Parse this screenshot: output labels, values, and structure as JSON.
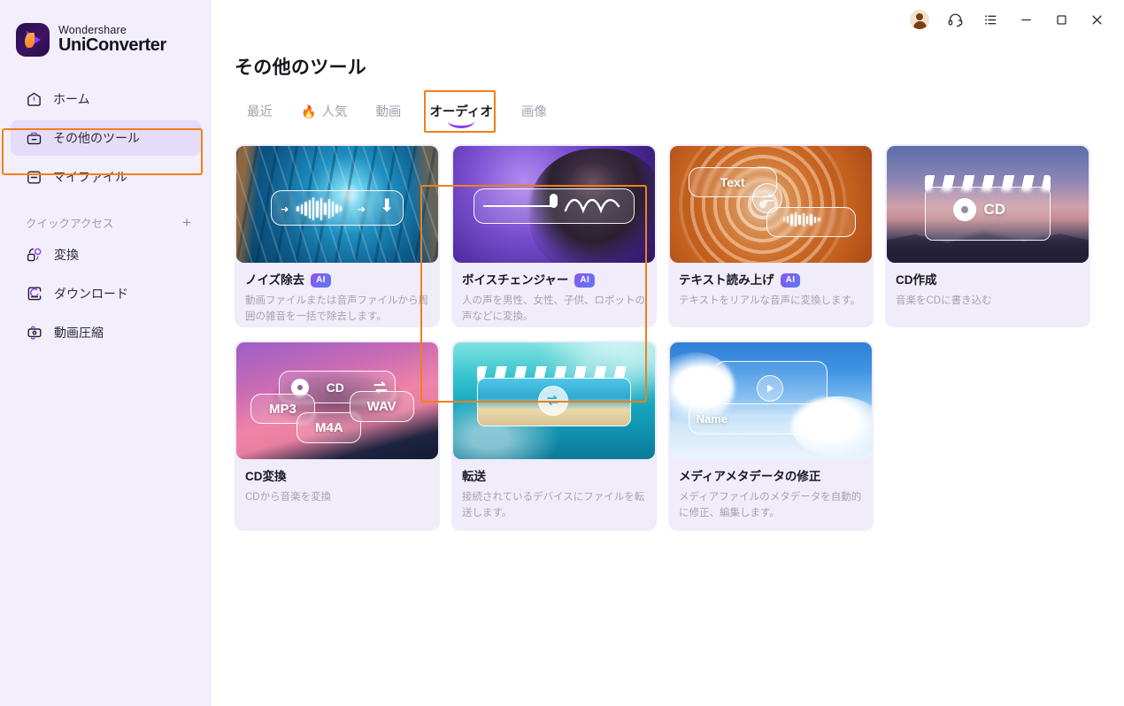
{
  "app": {
    "brand_top": "Wondershare",
    "brand_bottom": "UniConverter"
  },
  "titlebar": {
    "account_icon": "avatar-icon",
    "support_icon": "headset-icon",
    "menu_icon": "list-menu-icon",
    "minimize_icon": "minimize-icon",
    "maximize_icon": "maximize-icon",
    "close_icon": "close-icon"
  },
  "sidebar": {
    "items": [
      {
        "label": "ホーム",
        "icon": "home-icon",
        "active": false
      },
      {
        "label": "その他のツール",
        "icon": "toolbox-icon",
        "active": true
      },
      {
        "label": "マイファイル",
        "icon": "my-files-icon",
        "active": false
      }
    ],
    "quick_access": {
      "title": "クイックアクセス",
      "add_label": "+",
      "items": [
        {
          "label": "変換",
          "icon": "convert-icon"
        },
        {
          "label": "ダウンロード",
          "icon": "download-icon"
        },
        {
          "label": "動画圧縮",
          "icon": "video-compress-icon"
        }
      ]
    }
  },
  "main": {
    "page_title": "その他のツール",
    "tabs": [
      {
        "label": "最近",
        "icon": null,
        "active": false
      },
      {
        "label": "人気",
        "icon": "fire-emoji",
        "glyph": "🔥",
        "active": false
      },
      {
        "label": "動画",
        "icon": null,
        "active": false
      },
      {
        "label": "オーディオ",
        "icon": null,
        "active": true
      },
      {
        "label": "画像",
        "icon": null,
        "active": false
      }
    ],
    "cards": [
      {
        "title": "ノイズ除去",
        "badge": "AI",
        "desc": "動画ファイルまたは音声ファイルから周囲の雑音を一括で除去します。",
        "art": "art-noise",
        "row": 1
      },
      {
        "title": "ボイスチェンジャー",
        "badge": "AI",
        "desc": "人の声を男性、女性、子供、ロボットの声などに変換。",
        "art": "art-voice",
        "row": 1
      },
      {
        "title": "テキスト読み上げ",
        "badge": "AI",
        "desc": "テキストをリアルな音声に変換します。",
        "art": "art-tts",
        "overlay_text": "Text",
        "row": 1
      },
      {
        "title": "CD作成",
        "badge": null,
        "desc": "音楽をCDに書き込む",
        "art": "art-cd",
        "overlay_text": "CD",
        "row": 1
      },
      {
        "title": "CD変換",
        "badge": null,
        "desc": "CDから音楽を変換",
        "art": "art-cdconv",
        "overlay_text": "CD",
        "formats": [
          "MP3",
          "M4A",
          "WAV"
        ],
        "row": 2
      },
      {
        "title": "転送",
        "badge": null,
        "desc": "接続されているデバイスにファイルを転送します。",
        "art": "art-beach",
        "row": 2,
        "highlighted": true
      },
      {
        "title": "メディアメタデータの修正",
        "badge": null,
        "desc": "メディアファイルのメタデータを自動的に修正、編集します。",
        "art": "art-sky",
        "overlay_text": "Name",
        "row": 2
      }
    ]
  },
  "annotations": {
    "accent_color": "#f08019",
    "highlights": [
      "sidebar-item-その他のツール",
      "tab-オーディオ",
      "card-転送"
    ]
  }
}
